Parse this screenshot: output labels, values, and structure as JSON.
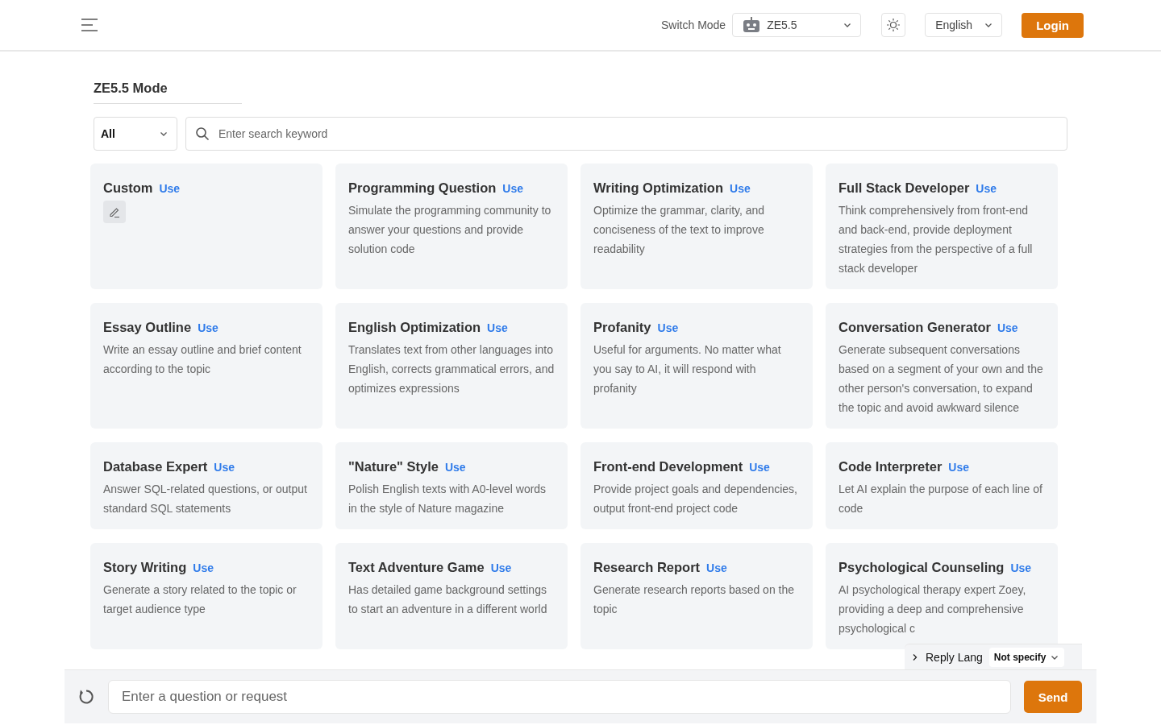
{
  "header": {
    "switch_label": "Switch Mode",
    "model": "ZE5.5",
    "language": "English",
    "login": "Login"
  },
  "page_title": "ZE5.5 Mode",
  "filter": {
    "value": "All"
  },
  "search": {
    "placeholder": "Enter search keyword"
  },
  "cards": [
    {
      "kind": "custom",
      "title": "Custom",
      "action": "Use"
    },
    {
      "kind": "preset",
      "title": "Programming Question",
      "action": "Use",
      "description": "Simulate the programming community to answer your questions and provide solution code"
    },
    {
      "kind": "preset",
      "title": "Writing Optimization",
      "action": "Use",
      "description": "Optimize the grammar, clarity, and conciseness of the text to improve readability"
    },
    {
      "kind": "preset",
      "title": "Full Stack Developer",
      "action": "Use",
      "description": "Think comprehensively from front-end and back-end, provide deployment strategies from the perspective of a full stack developer"
    },
    {
      "kind": "preset",
      "title": "Essay Outline",
      "action": "Use",
      "description": "Write an essay outline and brief content according to the topic"
    },
    {
      "kind": "preset",
      "title": "English Optimization",
      "action": "Use",
      "description": "Translates text from other languages into English, corrects grammatical errors, and optimizes expressions"
    },
    {
      "kind": "preset",
      "title": "Profanity",
      "action": "Use",
      "description": "Useful for arguments. No matter what you say to AI, it will respond with profanity"
    },
    {
      "kind": "preset",
      "title": "Conversation Generator",
      "action": "Use",
      "description": "Generate subsequent conversations based on a segment of your own and the other person's conversation, to expand the topic and avoid awkward silence"
    },
    {
      "kind": "preset",
      "title": "Database Expert",
      "action": "Use",
      "description": "Answer SQL-related questions, or output standard SQL statements"
    },
    {
      "kind": "preset",
      "title": "\"Nature\" Style",
      "action": "Use",
      "description": "Polish English texts with A0-level words in the style of Nature magazine"
    },
    {
      "kind": "preset",
      "title": "Front-end Development",
      "action": "Use",
      "description": "Provide project goals and dependencies, output front-end project code"
    },
    {
      "kind": "preset",
      "title": "Code Interpreter",
      "action": "Use",
      "description": "Let AI explain the purpose of each line of code"
    },
    {
      "kind": "preset",
      "title": "Story Writing",
      "action": "Use",
      "description": "Generate a story related to the topic or target audience type"
    },
    {
      "kind": "preset",
      "title": "Text Adventure Game",
      "action": "Use",
      "description": "Has detailed game background settings to start an adventure in a different world"
    },
    {
      "kind": "preset",
      "title": "Research Report",
      "action": "Use",
      "description": "Generate research reports based on the topic"
    },
    {
      "kind": "preset",
      "title": "Psychological Counseling",
      "action": "Use",
      "description": "AI psychological therapy expert Zoey, providing a deep and comprehensive psychological c"
    }
  ],
  "chat": {
    "reply_lang_label": "Reply Lang",
    "reply_lang": "Not specify",
    "placeholder": "Enter a question or request",
    "send": "Send"
  }
}
